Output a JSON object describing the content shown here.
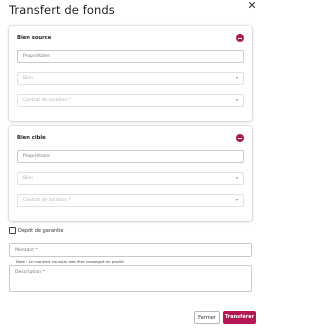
{
  "dialog": {
    "title": "Transfert de fonds",
    "close_icon": "close-icon"
  },
  "source": {
    "title": "Bien source",
    "owner_placeholder": "Propriétaire",
    "property_placeholder": "Bien",
    "lease_placeholder": "Contrat de location *"
  },
  "target": {
    "title": "Bien cible",
    "owner_placeholder": "Propriétaire",
    "property_placeholder": "Bien",
    "lease_placeholder": "Contrat de location *"
  },
  "deposit": {
    "label": "Dépôt de garantie",
    "checked": false
  },
  "amount": {
    "placeholder": "Montant *",
    "note": "Note : Le montant voulu(e) doit être renseigné en positif."
  },
  "description": {
    "placeholder": "Description *"
  },
  "actions": {
    "close_label": "Fermer",
    "transfer_label": "Transférer"
  },
  "colors": {
    "accent": "#b21852",
    "field_border": "#c9c9c9",
    "disabled_text": "#b3b3b3"
  }
}
